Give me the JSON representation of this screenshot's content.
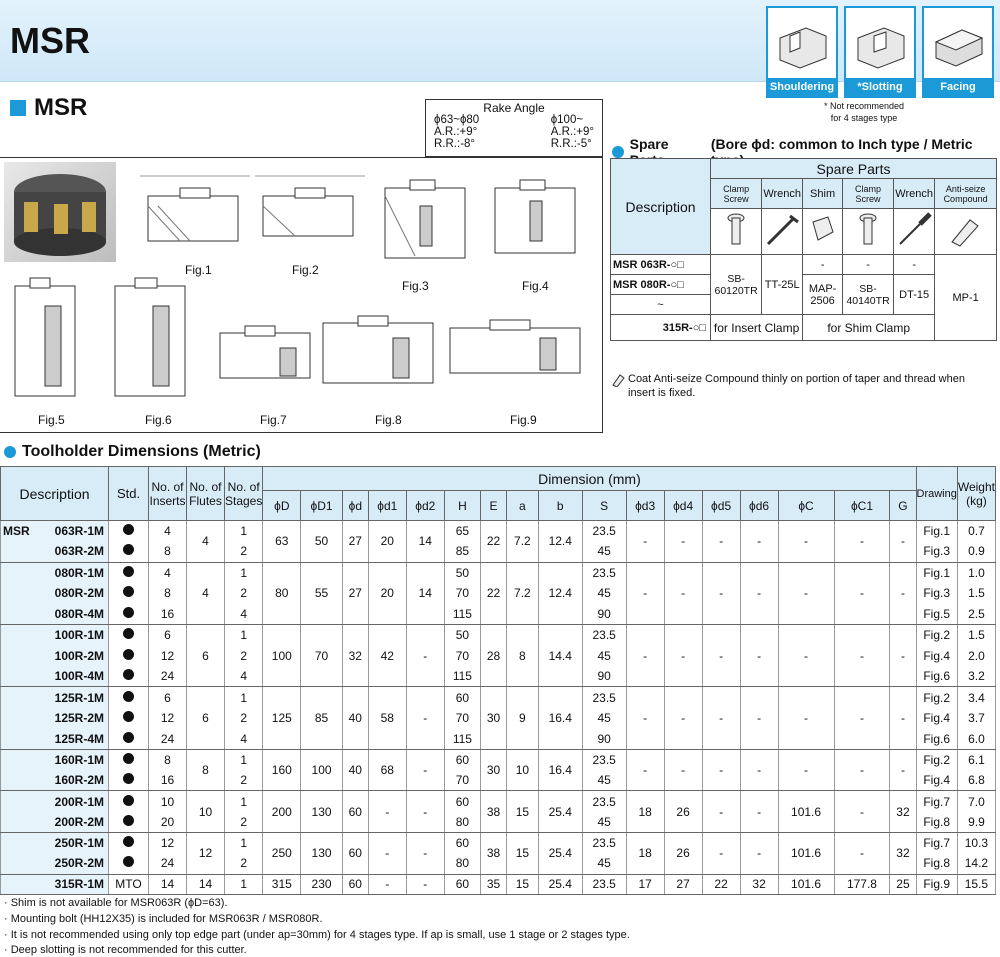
{
  "header": {
    "title": "MSR",
    "applications": [
      "Shouldering",
      "Slotting",
      "Facing"
    ],
    "slotting_mark": "*",
    "note_line1": "* Not recommended",
    "note_line2": "for 4 stages type"
  },
  "section_title": "MSR",
  "rake_angle": {
    "title": "Rake Angle",
    "col1": [
      "ϕ63~ϕ80",
      "A.R.:+9°",
      "R.R.:-8°"
    ],
    "col2": [
      "ϕ100~",
      "A.R.:+9°",
      "R.R.:-5°"
    ]
  },
  "figures": [
    "Fig.1",
    "Fig.2",
    "Fig.3",
    "Fig.4",
    "Fig.5",
    "Fig.6",
    "Fig.7",
    "Fig.8",
    "Fig.9"
  ],
  "spare_parts": {
    "title": "Spare Parts",
    "subtitle": "(Bore ϕd: common to Inch type / Metric type)",
    "header": "Spare Parts",
    "description": "Description",
    "columns": [
      "Clamp Screw",
      "Wrench",
      "Shim",
      "Clamp Screw",
      "Wrench",
      "Anti-seize Compound"
    ],
    "rows": [
      {
        "desc": "MSR  063R-○□",
        "vals": [
          "",
          "",
          "-",
          "-",
          "-"
        ]
      },
      {
        "desc": "MSR  080R-○□",
        "vals": [
          "SB-60120TR",
          "TT-25L",
          "MAP-2506",
          "SB-40140TR",
          "DT-15",
          "MP-1"
        ]
      },
      {
        "desc": "~",
        "vals": []
      },
      {
        "desc": "315R-○□",
        "vals": [
          "for Insert Clamp",
          "for Shim Clamp"
        ]
      }
    ],
    "note": "Coat Anti-seize Compound thinly on portion of taper and thread when insert is fixed."
  },
  "toolholder": {
    "title": "Toolholder Dimensions (Metric)",
    "headers": {
      "description": "Description",
      "std": "Std.",
      "inserts": "No. of Inserts",
      "flutes": "No. of Flutes",
      "stages": "No. of Stages",
      "dimension": "Dimension (mm)",
      "drawing": "Drawing",
      "weight": "Weight (kg)",
      "dims": [
        "ϕD",
        "ϕD1",
        "ϕd",
        "ϕd1",
        "ϕd2",
        "H",
        "E",
        "a",
        "b",
        "S",
        "ϕd3",
        "ϕd4",
        "ϕd5",
        "ϕd6",
        "ϕC",
        "ϕC1",
        "G"
      ]
    },
    "prefix": "MSR",
    "rows": [
      [
        "063R-1M",
        "●",
        "4",
        "4",
        "1",
        "63",
        "50",
        "27",
        "20",
        "14",
        "65",
        "22",
        "7.2",
        "12.4",
        "23.5",
        "-",
        "-",
        "-",
        "-",
        "-",
        "-",
        "-",
        "Fig.1",
        "0.7"
      ],
      [
        "063R-2M",
        "●",
        "8",
        "",
        "2",
        "",
        "",
        "",
        "",
        "",
        "85",
        "",
        "",
        "",
        "45",
        "",
        "",
        "",
        "",
        "",
        "",
        "",
        "Fig.3",
        "0.9"
      ],
      [
        "080R-1M",
        "●",
        "4",
        "4",
        "1",
        "80",
        "55",
        "27",
        "20",
        "14",
        "50",
        "22",
        "7.2",
        "12.4",
        "23.5",
        "-",
        "-",
        "-",
        "-",
        "-",
        "-",
        "-",
        "Fig.1",
        "1.0"
      ],
      [
        "080R-2M",
        "●",
        "8",
        "",
        "2",
        "",
        "",
        "",
        "",
        "",
        "70",
        "",
        "",
        "",
        "45",
        "",
        "",
        "",
        "",
        "",
        "",
        "",
        "Fig.3",
        "1.5"
      ],
      [
        "080R-4M",
        "●",
        "16",
        "",
        "4",
        "",
        "",
        "",
        "",
        "",
        "115",
        "",
        "",
        "",
        "90",
        "",
        "",
        "",
        "",
        "",
        "",
        "",
        "Fig.5",
        "2.5"
      ],
      [
        "100R-1M",
        "●",
        "6",
        "6",
        "1",
        "100",
        "70",
        "32",
        "42",
        "-",
        "50",
        "28",
        "8",
        "14.4",
        "23.5",
        "-",
        "-",
        "-",
        "-",
        "-",
        "-",
        "-",
        "Fig.2",
        "1.5"
      ],
      [
        "100R-2M",
        "●",
        "12",
        "",
        "2",
        "",
        "",
        "",
        "",
        "",
        "70",
        "",
        "",
        "",
        "45",
        "",
        "",
        "",
        "",
        "",
        "",
        "",
        "Fig.4",
        "2.0"
      ],
      [
        "100R-4M",
        "●",
        "24",
        "",
        "4",
        "",
        "",
        "",
        "",
        "",
        "115",
        "",
        "",
        "",
        "90",
        "",
        "",
        "",
        "",
        "",
        "",
        "",
        "Fig.6",
        "3.2"
      ],
      [
        "125R-1M",
        "●",
        "6",
        "6",
        "1",
        "125",
        "85",
        "40",
        "58",
        "-",
        "60",
        "30",
        "9",
        "16.4",
        "23.5",
        "-",
        "-",
        "-",
        "-",
        "-",
        "-",
        "-",
        "Fig.2",
        "3.4"
      ],
      [
        "125R-2M",
        "●",
        "12",
        "",
        "2",
        "",
        "",
        "",
        "",
        "",
        "70",
        "",
        "",
        "",
        "45",
        "",
        "",
        "",
        "",
        "",
        "",
        "",
        "Fig.4",
        "3.7"
      ],
      [
        "125R-4M",
        "●",
        "24",
        "",
        "4",
        "",
        "",
        "",
        "",
        "",
        "115",
        "",
        "",
        "",
        "90",
        "",
        "",
        "",
        "",
        "",
        "",
        "",
        "Fig.6",
        "6.0"
      ],
      [
        "160R-1M",
        "●",
        "8",
        "8",
        "1",
        "160",
        "100",
        "40",
        "68",
        "-",
        "60",
        "30",
        "10",
        "16.4",
        "23.5",
        "-",
        "-",
        "-",
        "-",
        "-",
        "-",
        "-",
        "Fig.2",
        "6.1"
      ],
      [
        "160R-2M",
        "●",
        "16",
        "",
        "2",
        "",
        "",
        "",
        "",
        "",
        "70",
        "",
        "",
        "",
        "45",
        "",
        "",
        "",
        "",
        "",
        "",
        "",
        "Fig.4",
        "6.8"
      ],
      [
        "200R-1M",
        "●",
        "10",
        "10",
        "1",
        "200",
        "130",
        "60",
        "-",
        "-",
        "60",
        "38",
        "15",
        "25.4",
        "23.5",
        "18",
        "26",
        "-",
        "-",
        "101.6",
        "-",
        "32",
        "Fig.7",
        "7.0"
      ],
      [
        "200R-2M",
        "●",
        "20",
        "",
        "2",
        "",
        "",
        "",
        "",
        "",
        "80",
        "",
        "",
        "",
        "45",
        "",
        "",
        "",
        "",
        "",
        "",
        "",
        "Fig.8",
        "9.9"
      ],
      [
        "250R-1M",
        "●",
        "12",
        "12",
        "1",
        "250",
        "130",
        "60",
        "-",
        "-",
        "60",
        "38",
        "15",
        "25.4",
        "23.5",
        "18",
        "26",
        "-",
        "-",
        "101.6",
        "-",
        "32",
        "Fig.7",
        "10.3"
      ],
      [
        "250R-2M",
        "●",
        "24",
        "",
        "2",
        "",
        "",
        "",
        "",
        "",
        "80",
        "",
        "",
        "",
        "45",
        "",
        "",
        "",
        "",
        "",
        "",
        "",
        "Fig.8",
        "14.2"
      ],
      [
        "315R-1M",
        "MTO",
        "14",
        "14",
        "1",
        "315",
        "230",
        "60",
        "-",
        "-",
        "60",
        "35",
        "15",
        "25.4",
        "23.5",
        "17",
        "27",
        "22",
        "32",
        "101.6",
        "177.8",
        "25",
        "Fig.9",
        "15.5"
      ]
    ],
    "footnotes": [
      "· Shim is not available for MSR063R (ϕD=63).",
      "· Mounting bolt (HH12X35) is included for MSR063R / MSR080R.",
      "· It is not recommended using only top edge part (under ap=30mm) for 4 stages type. If ap is small, use 1 stage or 2 stages type.",
      "· Deep slotting is not recommended for this cutter."
    ]
  }
}
